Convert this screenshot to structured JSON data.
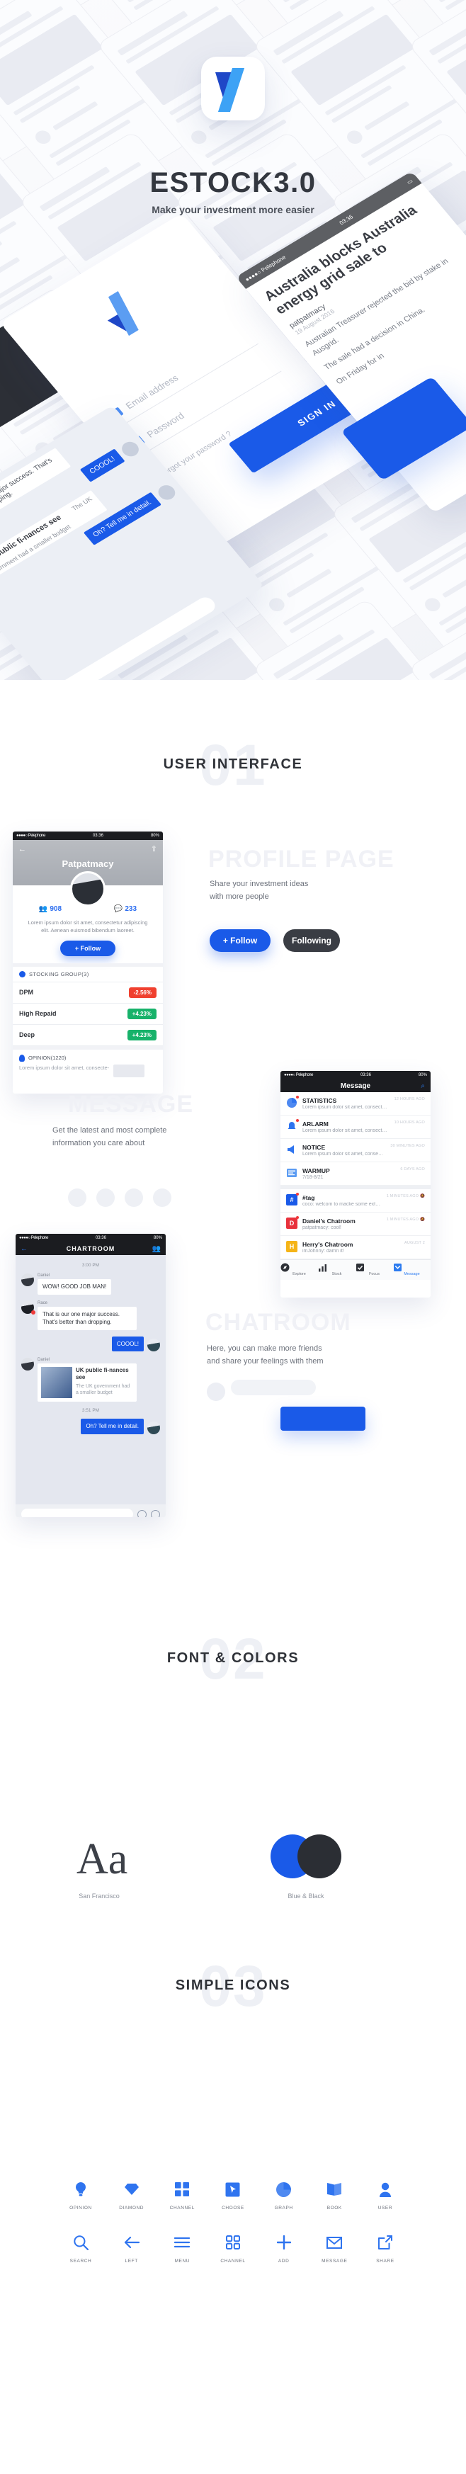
{
  "hero": {
    "app_title": "ESTOCK3.0",
    "tagline": "Make your investment more easier",
    "signin": {
      "email_placeholder": "Email address",
      "password_placeholder": "Password",
      "forgot_label": "Forgot your password ?",
      "button_label": "SIGN IN"
    },
    "news": {
      "status_carrier": "●●●●○ Pelephone",
      "status_time": "03:36",
      "headline": "Australia blocks Australia energy grid sale to",
      "author": "patpatmacy",
      "date": "19 August 2016",
      "paragraph1": "Australian Treasurer rejected the bid by stake in Ausgrid.",
      "paragraph2": "The sale had a decision in China.",
      "paragraph3": "On Friday for in"
    },
    "chat_preview": {
      "msg1": "That is our one major success. That's better than dropping.",
      "msg2": "COOOL!",
      "news_title": "UK public fi-nances see",
      "news_sub": "The UK government had a smaller budget",
      "msg3": "Oh? Tell me in detail."
    }
  },
  "section_ui": {
    "number": "01",
    "title": "USER INTERFACE",
    "profile": {
      "ghost": "PROFILE PAGE",
      "blurb": "Share your investment ideas\nwith more people",
      "follow_label": "+ Follow",
      "following_label": "Following"
    },
    "message": {
      "ghost": "MESSAGE",
      "blurb": "Get the latest and most complete\ninformation you care about"
    },
    "chatroom": {
      "ghost": "CHATROOM",
      "blurb": "Here, you can make more friends\nand share your feelings with them"
    }
  },
  "profile_phone": {
    "status_carrier": "●●●●○ Pelephone",
    "status_time": "03:36",
    "status_battery": "80%",
    "back_icon": "arrow-left-icon",
    "share_icon": "share-icon",
    "name": "Patpatmacy",
    "followers_count": "908",
    "comments_count": "233",
    "bio": "Lorem ipsum dolor sit amet, consectetur adipiscing elit. Aenean euismod bibendum laoreet.",
    "follow_label": "+ Follow",
    "group_header": "STOCKING GROUP(3)",
    "stocks": [
      {
        "name": "DPM",
        "change": "-2.56%",
        "color": "#f0402f"
      },
      {
        "name": "High Repaid",
        "change": "+4.23%",
        "color": "#17b26a"
      },
      {
        "name": "Deep",
        "change": "+4.23%",
        "color": "#17b26a"
      }
    ],
    "opinion_header": "OPINION(1220)",
    "opinion_text": "Lorem ipsum dolor sit amet, consecte-"
  },
  "message_phone": {
    "status_carrier": "●●●●○ Pelephone",
    "status_time": "03:36",
    "status_battery": "80%",
    "nav_title": "Message",
    "search_icon": "search-icon",
    "items": [
      {
        "title": "STATISTICS",
        "sub": "Lorem ipsum dolor sit amet, consectetur adip",
        "time": "12 HOURS AGO",
        "icon": "pie-chart-icon",
        "color": "#2f74ef",
        "unread": true,
        "type": "glyph"
      },
      {
        "title": "ARLARM",
        "sub": "Lorem ipsum dolor sit amet, consectetur adip",
        "time": "10 HOURS AGO",
        "icon": "bell-icon",
        "color": "#2f74ef",
        "unread": true,
        "type": "glyph"
      },
      {
        "title": "NOTICE",
        "sub": "Lorem ipsum dolor sit amet, consectetur adip",
        "time": "30 MINUTES AGO",
        "icon": "megaphone-icon",
        "color": "#2f74ef",
        "unread": false,
        "type": "glyph"
      },
      {
        "title": "WARMUP",
        "sub": "7/18-8/21",
        "time": "6 DAYS AGO",
        "icon": "news-icon",
        "color": "#5a9bf2",
        "unread": false,
        "type": "glyph"
      }
    ],
    "chats": [
      {
        "title": "#tag",
        "sub": "coco: welcom to macke some extra money...",
        "time": "1 MINUTES AGO",
        "avatar_letter": "#",
        "color": "#1a5ae8",
        "unread": true,
        "muted": true
      },
      {
        "title": "Daniel's Chatroom",
        "sub": "patpatmacy: cool!",
        "time": "1 MINUTES AGO",
        "avatar_letter": "D",
        "color": "#e8313c",
        "unread": true,
        "muted": true
      },
      {
        "title": "Herry's Chatroom",
        "sub": "imJohnny: damn it!",
        "time": "AUGUST 2",
        "avatar_letter": "H",
        "color": "#f5b418",
        "unread": false,
        "muted": false
      }
    ],
    "tabs": [
      {
        "label": "Explore",
        "icon": "compass-icon",
        "active": false
      },
      {
        "label": "Stock",
        "icon": "chart-icon",
        "active": false
      },
      {
        "label": "Focus",
        "icon": "check-icon",
        "active": false
      },
      {
        "label": "Message",
        "icon": "message-icon",
        "active": true
      }
    ]
  },
  "chat_phone": {
    "status_carrier": "●●●●○ Pelephone",
    "status_time": "03:36",
    "status_battery": "80%",
    "nav_title": "CHARTROOM",
    "back_icon": "arrow-left-icon",
    "people_icon": "user-group-icon",
    "timestamp1": "3:00 PM",
    "timestamp2": "3:51 PM",
    "messages": [
      {
        "who": "Daniel",
        "text": "WOW!  GOOD JOB MAN!",
        "side": "left",
        "type": "text"
      },
      {
        "who": "Race",
        "text": "That is our one major success. That's better than dropping.",
        "side": "left",
        "type": "text",
        "error": true
      },
      {
        "who": "",
        "text": "COOOL!",
        "side": "right",
        "type": "text"
      },
      {
        "who": "Daniel",
        "title": "UK public fi-nances see",
        "sub": "The UK government had a smaller budget",
        "side": "left",
        "type": "news"
      },
      {
        "who": "",
        "text": "Oh? Tell me in detail.",
        "side": "right",
        "type": "text"
      }
    ],
    "input_placeholder": "",
    "add_icon": "plus-circle-icon",
    "emoji_icon": "smiley-icon"
  },
  "section_font": {
    "number": "02",
    "title": "FONT & COLORS",
    "font_sample": "Aa",
    "font_label": "San Francisco",
    "color_label": "Blue & Black",
    "blue_hex": "#1A5AE8",
    "black_hex": "#2B2E34"
  },
  "section_icons": {
    "number": "03",
    "title": "SIMPLE ICONS",
    "row1": [
      {
        "label": "OPINION",
        "icon": "bulb-icon"
      },
      {
        "label": "DIAMOND",
        "icon": "diamond-icon"
      },
      {
        "label": "CHANNEL",
        "icon": "grid-filled-icon"
      },
      {
        "label": "CHOOSE",
        "icon": "cursor-box-icon"
      },
      {
        "label": "GRAPH",
        "icon": "pie-chart-icon"
      },
      {
        "label": "BOOK",
        "icon": "book-icon"
      },
      {
        "label": "USER",
        "icon": "user-icon"
      }
    ],
    "row2": [
      {
        "label": "SEARCH",
        "icon": "search-icon"
      },
      {
        "label": "LEFT",
        "icon": "arrow-left-icon"
      },
      {
        "label": "MENU",
        "icon": "menu-icon"
      },
      {
        "label": "CHANNEL",
        "icon": "grid-outline-icon"
      },
      {
        "label": "ADD",
        "icon": "plus-icon"
      },
      {
        "label": "MESSAGE",
        "icon": "envelope-icon"
      },
      {
        "label": "SHARE",
        "icon": "share-icon"
      }
    ]
  }
}
